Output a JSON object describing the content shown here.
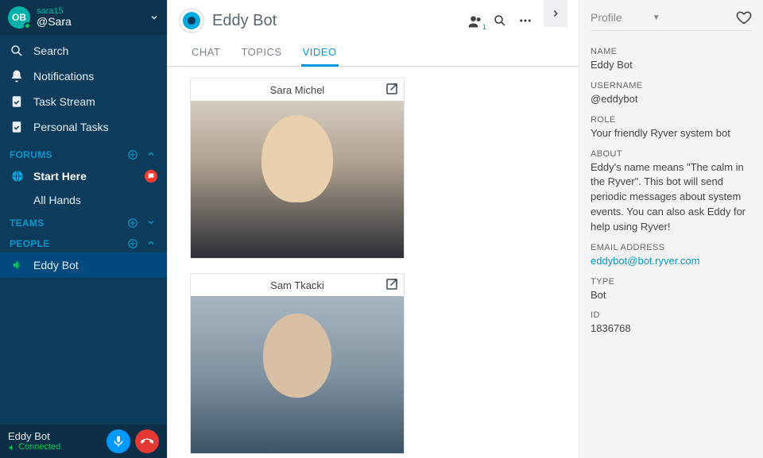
{
  "sidebar": {
    "user": {
      "top": "sara15",
      "main": "@Sara",
      "initials": "OB"
    },
    "nav": [
      {
        "label": "Search",
        "icon": "search"
      },
      {
        "label": "Notifications",
        "icon": "bell"
      },
      {
        "label": "Task Stream",
        "icon": "clipboard"
      },
      {
        "label": "Personal Tasks",
        "icon": "clipboard"
      }
    ],
    "sections": {
      "forums": {
        "title": "FORUMS",
        "items": [
          {
            "label": "Start Here",
            "bold": true,
            "badge": true
          },
          {
            "label": "All Hands"
          }
        ]
      },
      "teams": {
        "title": "TEAMS",
        "items": []
      },
      "people": {
        "title": "PEOPLE",
        "items": [
          {
            "label": "Eddy Bot",
            "active": true
          }
        ]
      }
    },
    "call": {
      "name": "Eddy Bot",
      "status": "Connected"
    }
  },
  "main": {
    "title": "Eddy Bot",
    "group_count": "1",
    "tabs": [
      {
        "label": "CHAT",
        "key": "chat"
      },
      {
        "label": "TOPICS",
        "key": "topics"
      },
      {
        "label": "VIDEO",
        "key": "video",
        "active": true
      }
    ],
    "videos": [
      {
        "name": "Sara Michel"
      },
      {
        "name": "Sam Tkacki"
      }
    ]
  },
  "profile": {
    "selector": "Profile",
    "fields": {
      "name": {
        "label": "NAME",
        "value": "Eddy Bot"
      },
      "username": {
        "label": "USERNAME",
        "value": "@eddybot"
      },
      "role": {
        "label": "ROLE",
        "value": "Your friendly Ryver system bot"
      },
      "about": {
        "label": "ABOUT",
        "value": "Eddy's name means \"The calm in the Ryver\". This bot will send periodic messages about system events. You can also ask Eddy for help using Ryver!"
      },
      "email": {
        "label": "EMAIL ADDRESS",
        "value": "eddybot@bot.ryver.com"
      },
      "type": {
        "label": "TYPE",
        "value": "Bot"
      },
      "id": {
        "label": "ID",
        "value": "1836768"
      }
    }
  }
}
